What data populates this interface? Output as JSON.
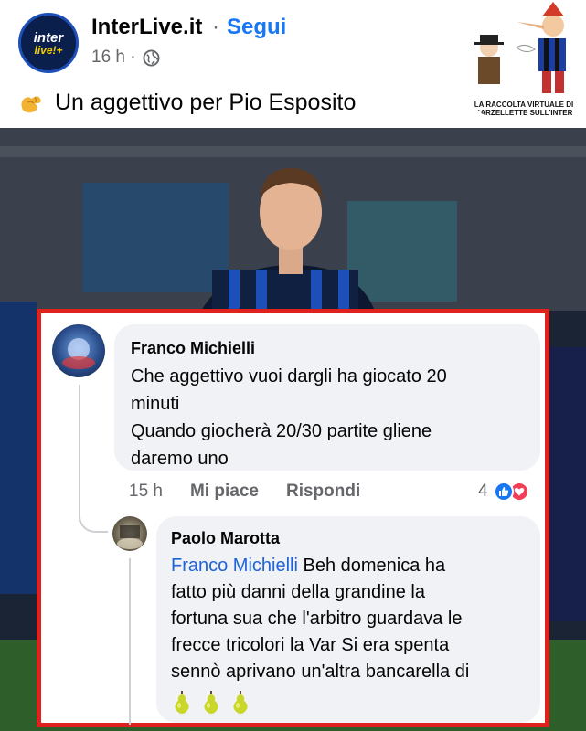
{
  "post": {
    "page_name": "InterLive.it",
    "separator": "·",
    "follow_label": "Segui",
    "time": "16 h ·",
    "text": "Un aggettivo per Pio Esposito",
    "avatar_logo_top": "inter",
    "avatar_logo_bottom": "live!+",
    "text_icon": "flexed-biceps-icon"
  },
  "overlay_logo": {
    "caption": "LA RACCOLTA VIRTUALE DI BARZELLETTE SULL'INTER"
  },
  "comments": [
    {
      "author": "Franco Michielli",
      "text_lines": [
        "Che aggettivo vuoi dargli ha giocato 20",
        "minuti",
        "Quando giocherà 20/30 partite gliene",
        "daremo uno"
      ],
      "time": "15 h",
      "like_label": "Mi piace",
      "reply_label": "Rispondi",
      "reaction_count": "4",
      "reaction_icons": [
        "like-reaction-icon",
        "love-reaction-icon"
      ]
    },
    {
      "author": "Paolo Marotta",
      "mention": "Franco Michielli",
      "text_lines": [
        " Beh domenica ha",
        "fatto più danni della grandine la",
        "fortuna sua che l'arbitro guardava le",
        "frecce tricolori la Var Si era spenta",
        "sennò aprivano un'altra bancarella di"
      ],
      "emoji": [
        "pear-icon",
        "pear-icon",
        "pear-icon"
      ]
    }
  ],
  "colors": {
    "link_blue": "#1877f2",
    "mention_blue": "#1e63d8",
    "highlight_red": "#e0221f",
    "bubble_bg": "#f0f2f5",
    "muted_text": "#65676b"
  }
}
